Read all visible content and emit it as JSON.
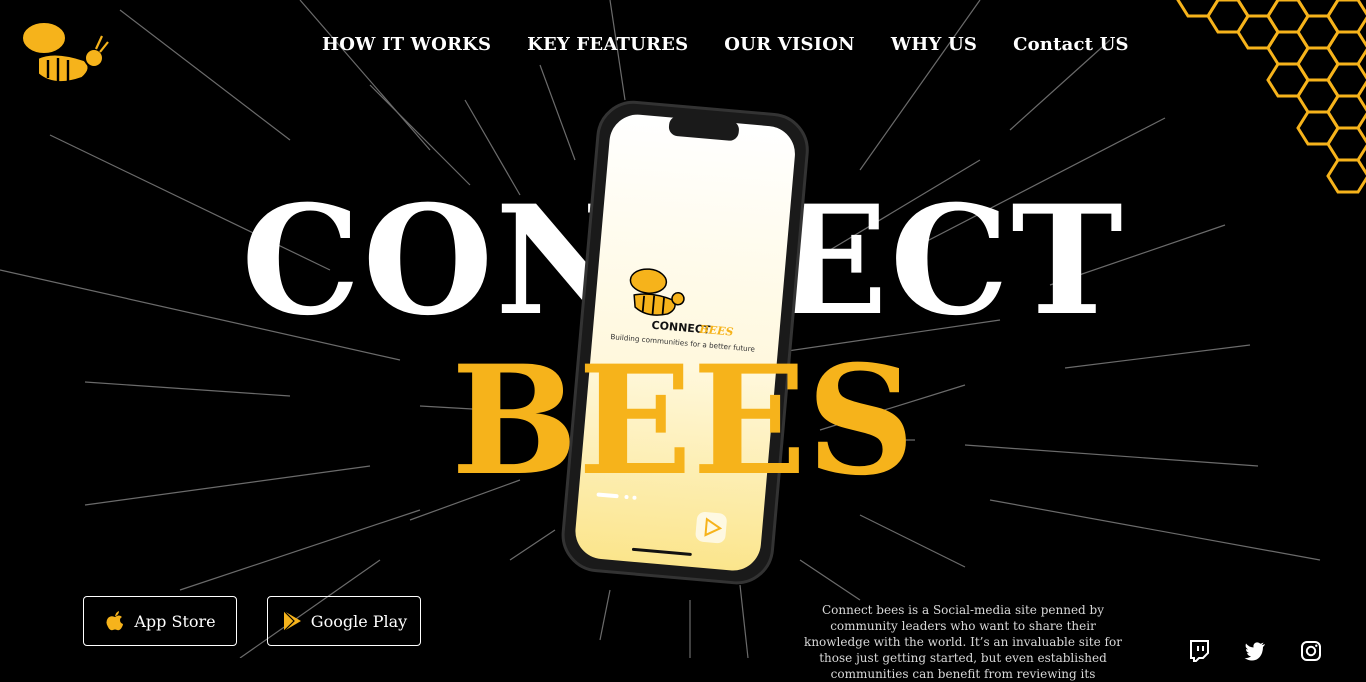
{
  "nav": {
    "items": [
      "HOW IT WORKS",
      "KEY FEATURES",
      "OUR VISION",
      "WHY US",
      "Contact US"
    ]
  },
  "logo": {
    "text": "CONNECT bees"
  },
  "hero": {
    "title": "CONNECT",
    "subtitle": "BEES"
  },
  "phone_screen": {
    "brand": "CONNECTBEES",
    "tagline": "Building communities for a better future"
  },
  "stores": {
    "app_store": "App Store",
    "google_play": "Google Play"
  },
  "about": "Connect bees is a Social-media site penned by community leaders who want to share their knowledge with the world. It’s an invaluable site for those just getting started, but even established communities can benefit from reviewing its",
  "colors": {
    "accent": "#f6b31b",
    "background": "#000000",
    "text": "#ffffff"
  },
  "social": [
    "twitch-icon",
    "twitter-icon",
    "instagram-icon"
  ]
}
